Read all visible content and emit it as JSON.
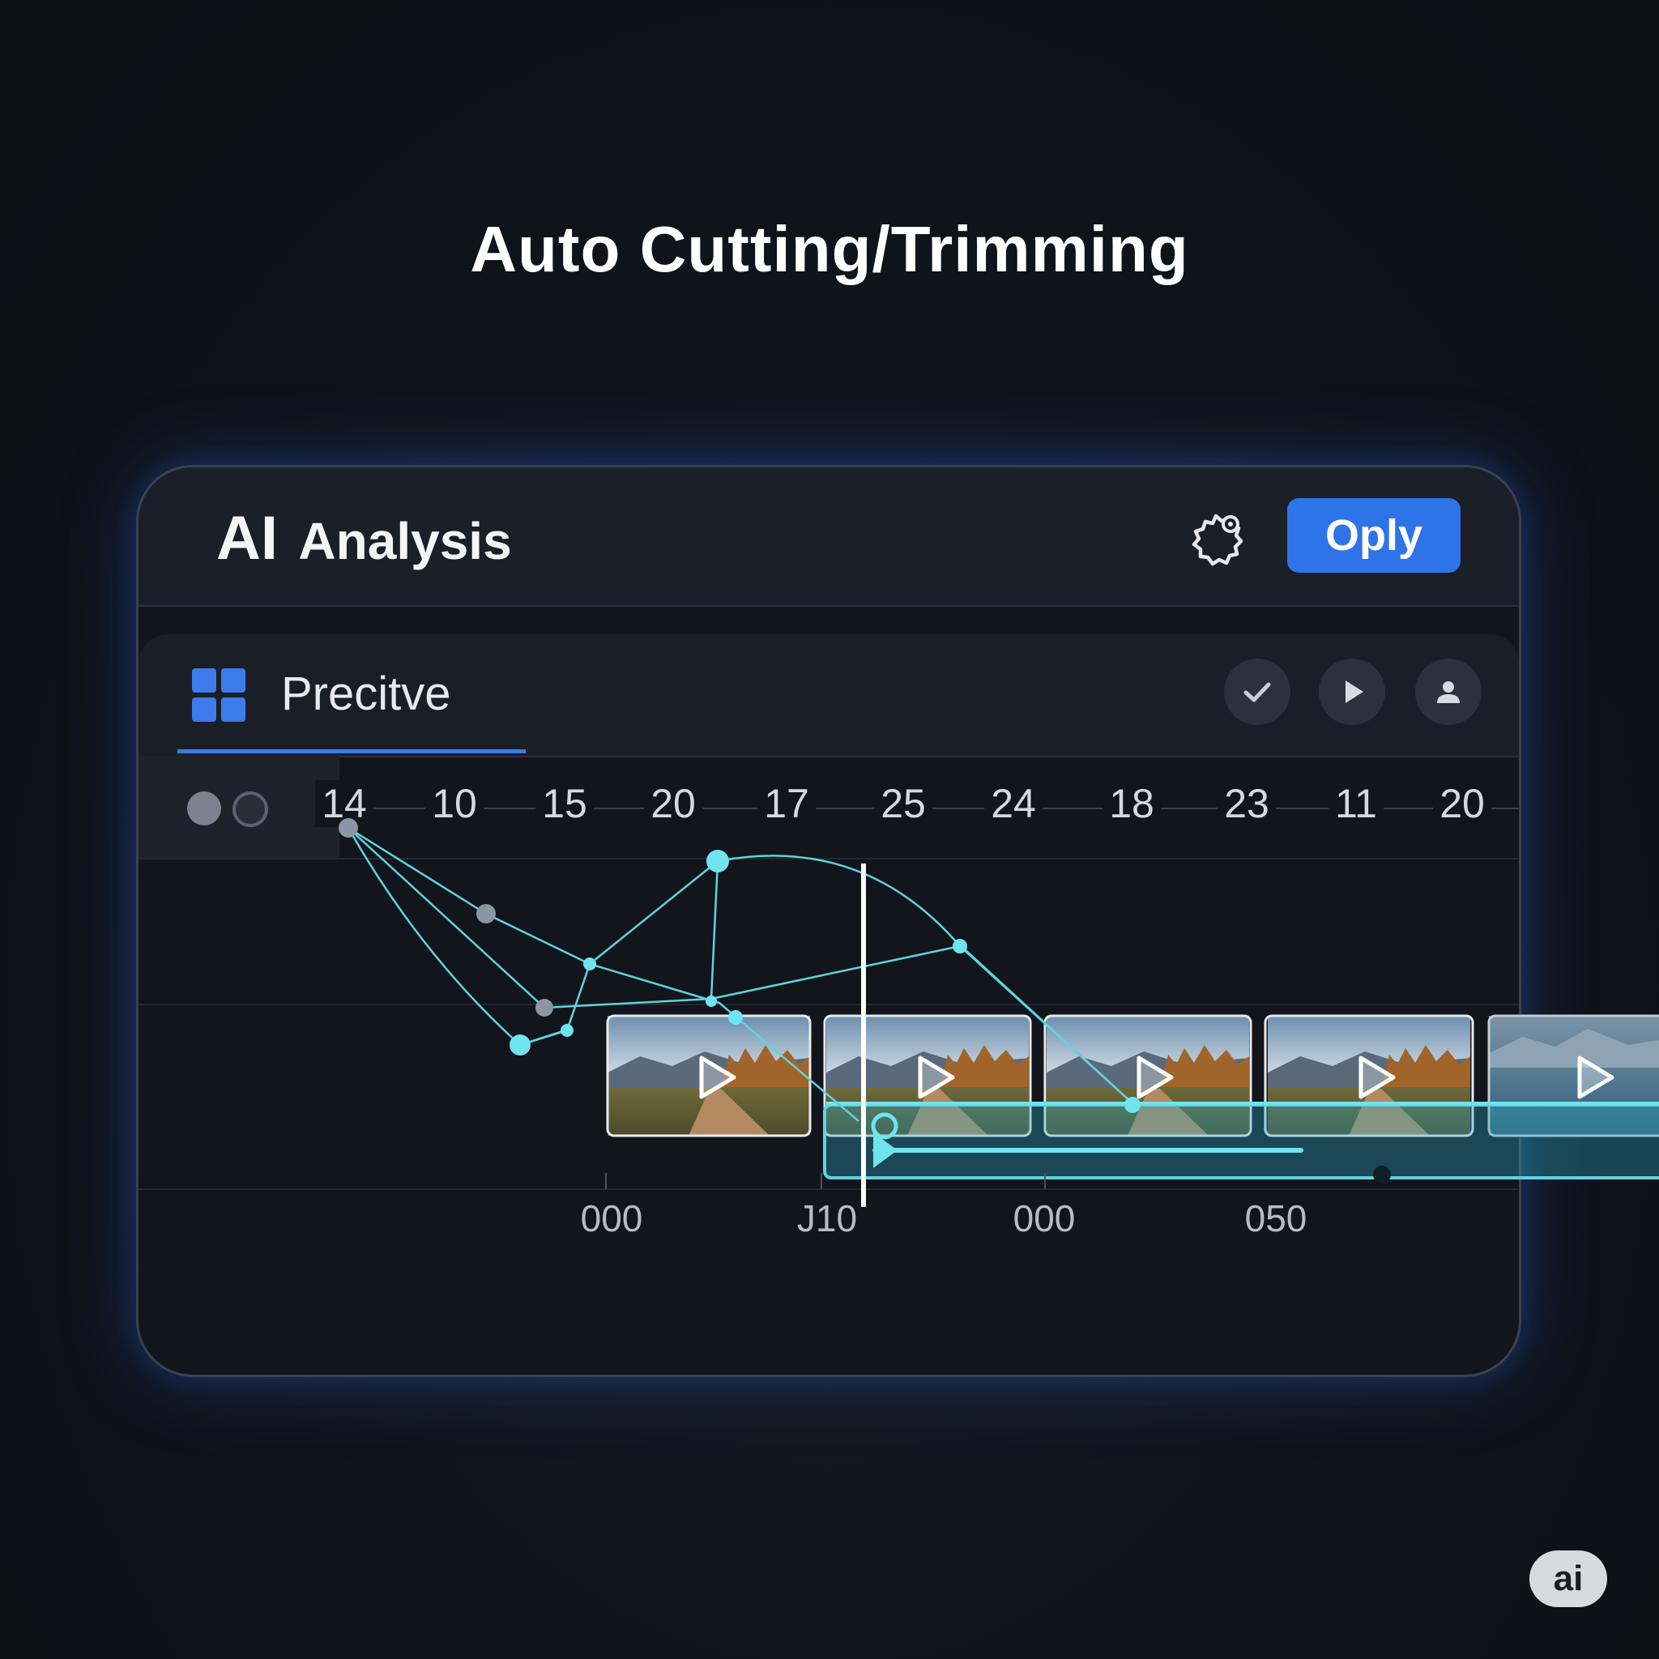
{
  "page": {
    "heading": "Auto Cutting/Trimming"
  },
  "header": {
    "title_ai": "AI",
    "title_rest": "Analysis",
    "settings_icon": "gear-icon",
    "apply_label": "Oply"
  },
  "tab": {
    "icon": "grid-icon",
    "label": "Precitve",
    "actions": [
      {
        "name": "check-icon"
      },
      {
        "name": "play-icon"
      },
      {
        "name": "user-icon"
      }
    ]
  },
  "ruler": {
    "labels": [
      "14",
      "10",
      "15",
      "20",
      "17",
      "25",
      "24",
      "18",
      "23",
      "11",
      "20"
    ]
  },
  "timeline": {
    "bottom_labels": [
      "000",
      "J10",
      "000",
      "050"
    ],
    "clips": [
      {
        "name": "clip-1",
        "icon": "play-icon"
      },
      {
        "name": "clip-2",
        "icon": "play-icon"
      },
      {
        "name": "clip-3",
        "icon": "play-icon"
      },
      {
        "name": "clip-4",
        "icon": "play-icon"
      },
      {
        "name": "clip-5",
        "icon": "play-icon"
      }
    ]
  },
  "badge": {
    "label": "ai"
  },
  "colors": {
    "accent": "#2f73e8",
    "curve": "#5fd3e0",
    "track": "#1f6f80",
    "background": "#10131a"
  }
}
